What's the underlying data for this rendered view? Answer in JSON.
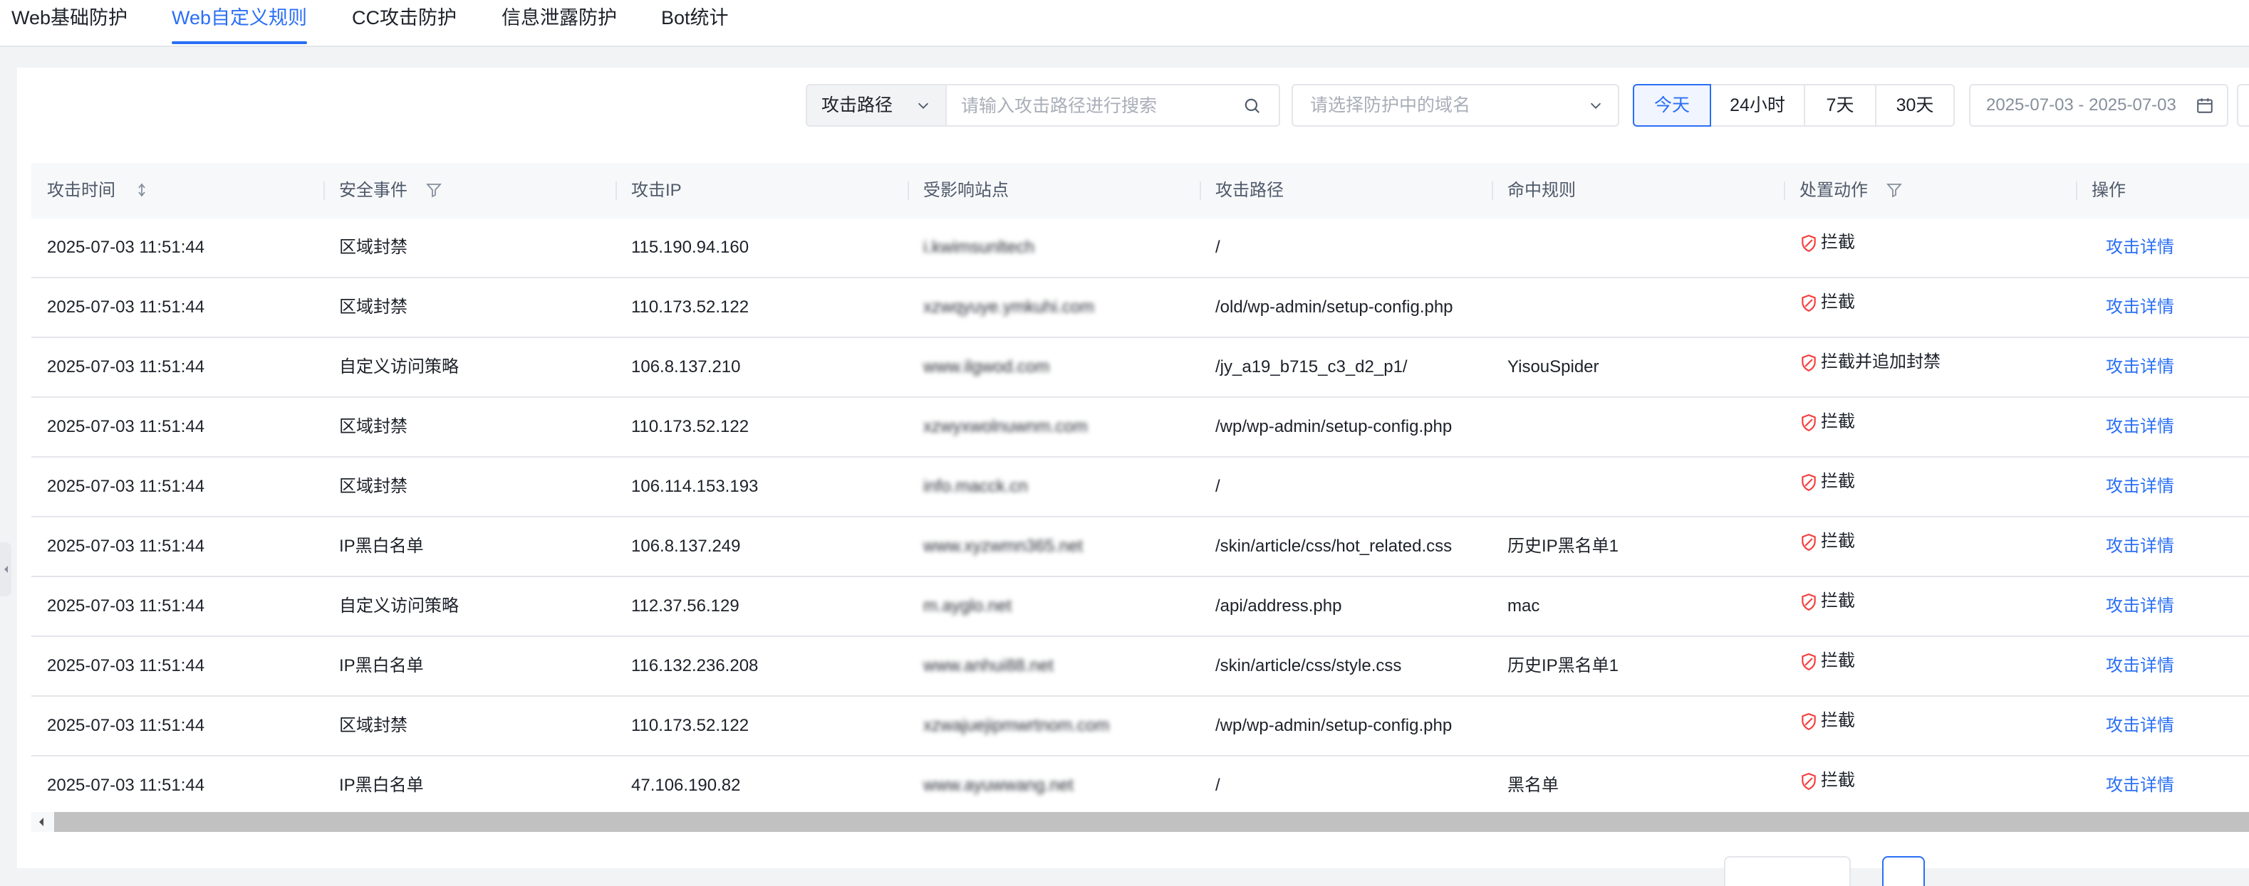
{
  "tabs": [
    {
      "label": "Web基础防护",
      "active": false
    },
    {
      "label": "Web自定义规则",
      "active": true
    },
    {
      "label": "CC攻击防护",
      "active": false
    },
    {
      "label": "信息泄露防护",
      "active": false
    },
    {
      "label": "Bot统计",
      "active": false
    }
  ],
  "toolbar": {
    "search_field_select": "攻击路径",
    "search_placeholder": "请输入攻击路径进行搜索",
    "domain_placeholder": "请选择防护中的域名",
    "time_ranges": [
      "今天",
      "24小时",
      "7天",
      "30天"
    ],
    "active_range": "今天",
    "date_range": "2025-07-03 - 2025-07-03"
  },
  "table": {
    "columns": [
      "攻击时间",
      "安全事件",
      "攻击IP",
      "受影响站点",
      "攻击路径",
      "命中规则",
      "处置动作",
      "操作"
    ],
    "rows": [
      {
        "time": "2025-07-03 11:51:44",
        "event": "区域封禁",
        "ip": "115.190.94.160",
        "site": "i.kwimsunltech",
        "path": "/",
        "rule": "",
        "action": "拦截",
        "op": "攻击详情"
      },
      {
        "time": "2025-07-03 11:51:44",
        "event": "区域封禁",
        "ip": "110.173.52.122",
        "site": "xzwqyuye.ymkuhi.com",
        "path": "/old/wp-admin/setup-config.php",
        "rule": "",
        "action": "拦截",
        "op": "攻击详情"
      },
      {
        "time": "2025-07-03 11:51:44",
        "event": "自定义访问策略",
        "ip": "106.8.137.210",
        "site": "www.ilgwod.com",
        "path": "/jy_a19_b715_c3_d2_p1/",
        "rule": "YisouSpider",
        "action": "拦截并追加封禁",
        "op": "攻击详情"
      },
      {
        "time": "2025-07-03 11:51:44",
        "event": "区域封禁",
        "ip": "110.173.52.122",
        "site": "xzwyxwolnuwnm.com",
        "path": "/wp/wp-admin/setup-config.php",
        "rule": "",
        "action": "拦截",
        "op": "攻击详情"
      },
      {
        "time": "2025-07-03 11:51:44",
        "event": "区域封禁",
        "ip": "106.114.153.193",
        "site": "info.macck.cn",
        "path": "/",
        "rule": "",
        "action": "拦截",
        "op": "攻击详情"
      },
      {
        "time": "2025-07-03 11:51:44",
        "event": "IP黑白名单",
        "ip": "106.8.137.249",
        "site": "www.xyzwmn365.net",
        "path": "/skin/article/css/hot_related.css",
        "rule": "历史IP黑名单1",
        "action": "拦截",
        "op": "攻击详情"
      },
      {
        "time": "2025-07-03 11:51:44",
        "event": "自定义访问策略",
        "ip": "112.37.56.129",
        "site": "m.ayglo.net",
        "path": "/api/address.php",
        "rule": "mac",
        "action": "拦截",
        "op": "攻击详情"
      },
      {
        "time": "2025-07-03 11:51:44",
        "event": "IP黑白名单",
        "ip": "116.132.236.208",
        "site": "www.anhui88.net",
        "path": "/skin/article/css/style.css",
        "rule": "历史IP黑名单1",
        "action": "拦截",
        "op": "攻击详情"
      },
      {
        "time": "2025-07-03 11:51:44",
        "event": "区域封禁",
        "ip": "110.173.52.122",
        "site": "xzwajuejipmwrtnom.com",
        "path": "/wp/wp-admin/setup-config.php",
        "rule": "",
        "action": "拦截",
        "op": "攻击详情"
      },
      {
        "time": "2025-07-03 11:51:44",
        "event": "IP黑白名单",
        "ip": "47.106.190.82",
        "site": "www.ayuwwang.net",
        "path": "/",
        "rule": "黑名单",
        "action": "拦截",
        "op": "攻击详情"
      }
    ]
  },
  "colors": {
    "accent": "#2a6ff5",
    "danger": "#f53f3f"
  }
}
